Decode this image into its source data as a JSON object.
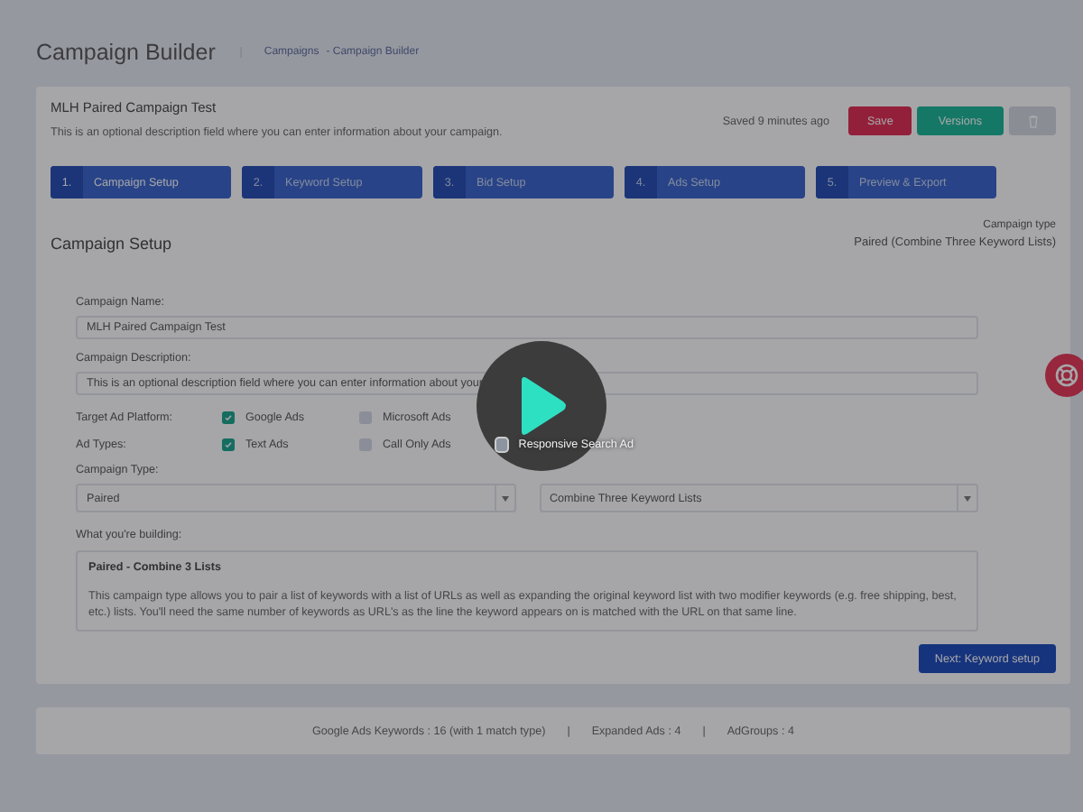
{
  "header": {
    "title": "Campaign Builder",
    "breadcrumbs": [
      "Campaigns",
      "- Campaign Builder"
    ]
  },
  "campaign": {
    "name": "MLH Paired Campaign Test",
    "description": "This is an optional description field where you can enter information about your campaign.",
    "saved": "Saved 9 minutes ago",
    "save_button": "Save",
    "versions_button": "Versions"
  },
  "steps": [
    {
      "number": "1.",
      "label": "Campaign Setup",
      "selected": true
    },
    {
      "number": "2.",
      "label": "Keyword Setup",
      "selected": false
    },
    {
      "number": "3.",
      "label": "Bid Setup",
      "selected": false
    },
    {
      "number": "4.",
      "label": "Ads Setup",
      "selected": false
    },
    {
      "number": "5.",
      "label": "Preview & Export",
      "selected": false
    }
  ],
  "section": {
    "title": "Campaign Setup",
    "type_label": "Campaign type",
    "type_value": "Paired (Combine Three Keyword Lists)"
  },
  "form": {
    "name_label": "Campaign Name:",
    "name_value": "MLH Paired Campaign Test",
    "description_label": "Campaign Description:",
    "description_value": "This is an optional description field where you can enter information about your",
    "checkbox_rows": [
      {
        "label": "Target Ad Platform:",
        "options": [
          {
            "label": "Google Ads",
            "checked": true
          },
          {
            "label": "Microsoft Ads",
            "checked": false
          }
        ]
      },
      {
        "label": "Ad Types:",
        "options": [
          {
            "label": "Text Ads",
            "checked": true
          },
          {
            "label": "Call Only Ads",
            "checked": false
          },
          {
            "label": "Responsive Search Ad",
            "checked": false
          }
        ]
      }
    ],
    "type_label": "Campaign Type:",
    "selects": [
      "Paired",
      "Combine Three Keyword Lists"
    ],
    "building_label": "What you're building:",
    "info_title": "Paired - Combine 3 Lists",
    "info_text": "This campaign type allows you to pair a list of keywords with a list of URLs as well as expanding the original keyword list with two modifier keywords (e.g. free shipping, best, etc.) lists. You'll need the same number of keywords as URL's as the line the keyword appears on is matched with the URL on that same line.",
    "next_button": "Next: Keyword setup"
  },
  "footer": [
    "Google Ads Keywords : 16 (with 1 match type)",
    "|",
    "Expanded Ads : 4",
    "|",
    "AdGroups : 4"
  ]
}
